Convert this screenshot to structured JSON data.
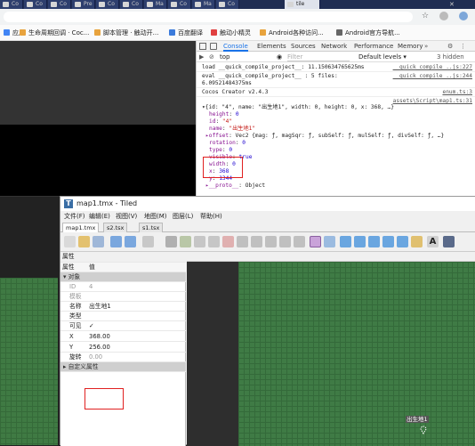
{
  "browser": {
    "tabs": [
      "Co",
      "Co",
      "Co",
      "Pre",
      "Co",
      "Co",
      "Ma",
      "Co",
      "Ma",
      "Co",
      "tile"
    ],
    "bookmarks": [
      {
        "label": "应用",
        "color": "#4285f4"
      },
      {
        "label": "生命周期回调 · Coc...",
        "color": "#e8a33d"
      },
      {
        "label": "脚本管理 · 触动开...",
        "color": "#e8a33d"
      },
      {
        "label": "百度翻译",
        "color": "#3b7bdb"
      },
      {
        "label": "触动小精灵",
        "color": "#e04040"
      },
      {
        "label": "Android各种访问...",
        "color": "#e8a33d"
      },
      {
        "label": "Android官方导航...",
        "color": "#666666"
      }
    ]
  },
  "devtools": {
    "tabs": [
      "Console",
      "Elements",
      "Sources",
      "Network",
      "Performance",
      "Memory"
    ],
    "context": "top",
    "filter_placeholder": "Filter",
    "levels": "Default levels ▾",
    "hidden": "3 hidden",
    "console_lines": [
      {
        "text": "load __quick_compile_project__: 11.150634765625ms",
        "src": "__quick_compile_..js:227"
      },
      {
        "text": "eval __quick_compile_project__ : 5 files:",
        "src": "__quick_compile_..js:244"
      },
      {
        "text": "6.09521484375ms",
        "src": ""
      },
      {
        "text": "Cocos Creator v2.4.3",
        "src": "enum.ts:3"
      },
      {
        "text": "",
        "src": "assets\\Script\\map1.ts:31"
      }
    ],
    "object_summary": "▾{id: \"4\", name: \"出生地1\", width: 0, height: 0, x: 368, …}",
    "object_props": [
      {
        "key": "height",
        "value": "0"
      },
      {
        "key": "id",
        "value": "\"4\""
      },
      {
        "key": "name",
        "value": "\"出生地1\""
      },
      {
        "key": "▸offset",
        "value": "Vec2 {mag: ƒ, magSqr: ƒ, subSelf: ƒ, mulSelf: ƒ, divSelf: ƒ, …}"
      },
      {
        "key": "rotation",
        "value": "0"
      },
      {
        "key": "type",
        "value": "0"
      },
      {
        "key": "visible",
        "value": "true"
      },
      {
        "key": "width",
        "value": "0"
      },
      {
        "key": "x",
        "value": "368"
      },
      {
        "key": "y",
        "value": "1344"
      },
      {
        "key": "▸__proto__",
        "value": "Object"
      }
    ]
  },
  "tiled": {
    "title": "map1.tmx - Tiled",
    "menu": [
      "文件(F)",
      "编辑(E)",
      "视图(V)",
      "地图(M)",
      "图层(L)",
      "帮助(H)"
    ],
    "doc_tabs": [
      "map1.tmx",
      "s2.tsx",
      "s1.tsx"
    ],
    "props_header": "属性",
    "col_prop": "属性",
    "col_value": "值",
    "group_object": "对象",
    "group_custom": "自定义属性",
    "rows": [
      {
        "key": "ID",
        "value": "4",
        "disabled": true
      },
      {
        "key": "模板",
        "value": "",
        "disabled": true
      },
      {
        "key": "名称",
        "value": "出生地1",
        "disabled": false
      },
      {
        "key": "类型",
        "value": "",
        "disabled": false
      },
      {
        "key": "可见",
        "value": "✓",
        "disabled": false
      },
      {
        "key": "X",
        "value": "368.00",
        "disabled": false
      },
      {
        "key": "Y",
        "value": "256.00",
        "disabled": false
      },
      {
        "key": "旋转",
        "value": "0.00",
        "disabled": true
      }
    ],
    "object_label": "出生地1"
  }
}
